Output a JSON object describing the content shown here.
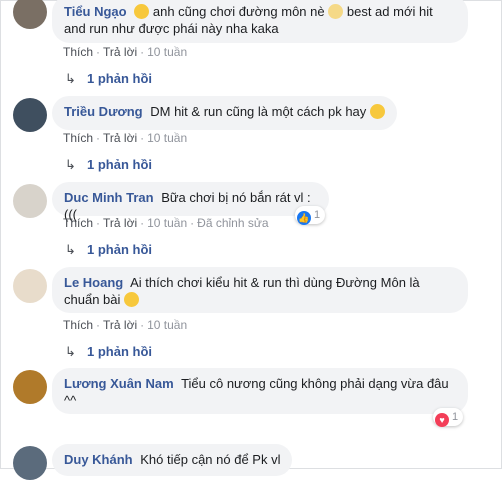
{
  "action_like": "Thích",
  "action_reply": "Trả lời",
  "comments": [
    {
      "name": "Tiểu Ngạo",
      "text_a": "anh cũng chơi đường môn nè",
      "text_b": "best ad mới hit and run như được phái này nha kaka",
      "time": "10 tuần",
      "replies": "1 phản hồi"
    },
    {
      "name": "Triều Dương",
      "text": "DM hit & run cũng là một cách pk hay",
      "time": "10 tuần",
      "replies": "1 phản hồi"
    },
    {
      "name": "Duc Minh Tran",
      "text": "Bữa chơi bị nó bắn rát vl :(((",
      "time": "10 tuần",
      "edited": "Đã chỉnh sửa",
      "reactions": "1",
      "replies": "1 phản hồi"
    },
    {
      "name": "Le Hoang",
      "text": "Ai thích chơi kiểu hit & run thì dùng Đường Môn là chuẩn bài",
      "time": "10 tuần",
      "replies": "1 phản hồi"
    },
    {
      "name": "Lương Xuân Nam",
      "text": "Tiểu cô nương cũng không phải dạng vừa đâu ^^",
      "reactions": "1"
    },
    {
      "name": "Duy Khánh",
      "text": "Khó tiếp cận nó để Pk vl"
    }
  ],
  "colors": {
    "name": "#385898",
    "bubble": "#f2f3f5",
    "meta": "#90949c",
    "like": "#1877f2",
    "love": "#f33e58"
  }
}
